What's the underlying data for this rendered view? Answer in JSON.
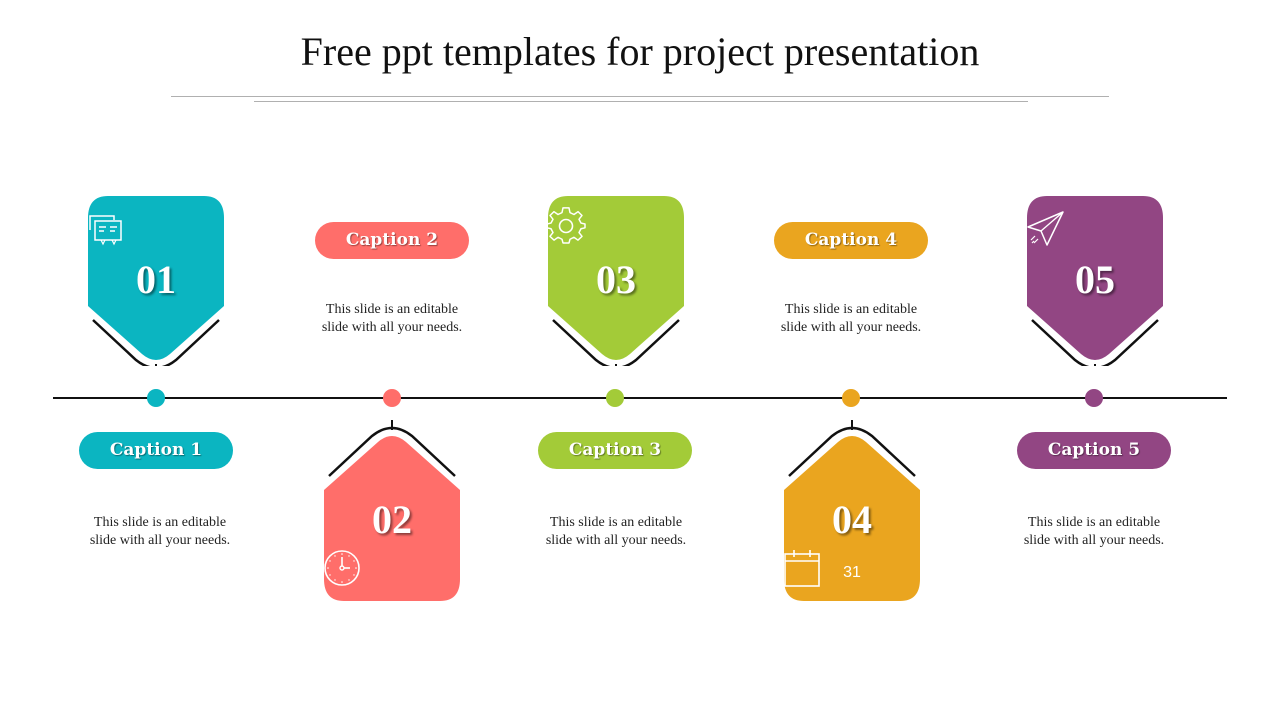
{
  "slide": {
    "title": "Free ppt templates for project presentation"
  },
  "steps": [
    {
      "number": "01",
      "icon": "presentation-boards-icon",
      "caption": "Caption 1",
      "description_line1": "This slide is an editable",
      "description_line2": "slide with all your needs.",
      "color": "#0BB5C1",
      "position": "above"
    },
    {
      "number": "02",
      "icon": "clock-icon",
      "caption": "Caption 2",
      "description_line1": "This slide is an editable",
      "description_line2": "slide with all your needs.",
      "color": "#FF6E6A",
      "position": "below"
    },
    {
      "number": "03",
      "icon": "gear-icon",
      "caption": "Caption 3",
      "description_line1": "This slide is an editable",
      "description_line2": "slide with all your needs.",
      "color": "#A3CB38",
      "position": "above"
    },
    {
      "number": "04",
      "icon": "calendar-icon",
      "caption": "Caption 4",
      "description_line1": "This slide is an editable",
      "description_line2": "slide with all your needs.",
      "color": "#EAA51F",
      "position": "below",
      "calendar_day": "31"
    },
    {
      "number": "05",
      "icon": "paper-plane-icon",
      "caption": "Caption 5",
      "description_line1": "This slide is an editable",
      "description_line2": "slide with all your needs.",
      "color": "#924683",
      "position": "above"
    }
  ]
}
